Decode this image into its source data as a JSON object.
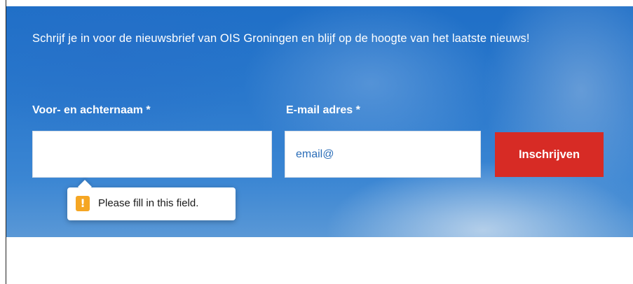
{
  "newsletter": {
    "intro_text": "Schrijf je in voor de nieuwsbrief van OIS Groningen en blijf op de hoogte van het laatste nieuws!",
    "name_label": "Voor- en achternaam *",
    "name_value": "",
    "email_label": "E-mail adres *",
    "email_value": "email@",
    "submit_label": "Inschrijven",
    "validation_message": "Please fill in this field.",
    "warning_glyph": "!",
    "colors": {
      "background": "#2a78cc",
      "submit_button": "#d72b25",
      "warning_icon": "#f5a623",
      "input_text": "#2a6db8"
    }
  },
  "icons": {
    "validation": "warning-icon"
  }
}
